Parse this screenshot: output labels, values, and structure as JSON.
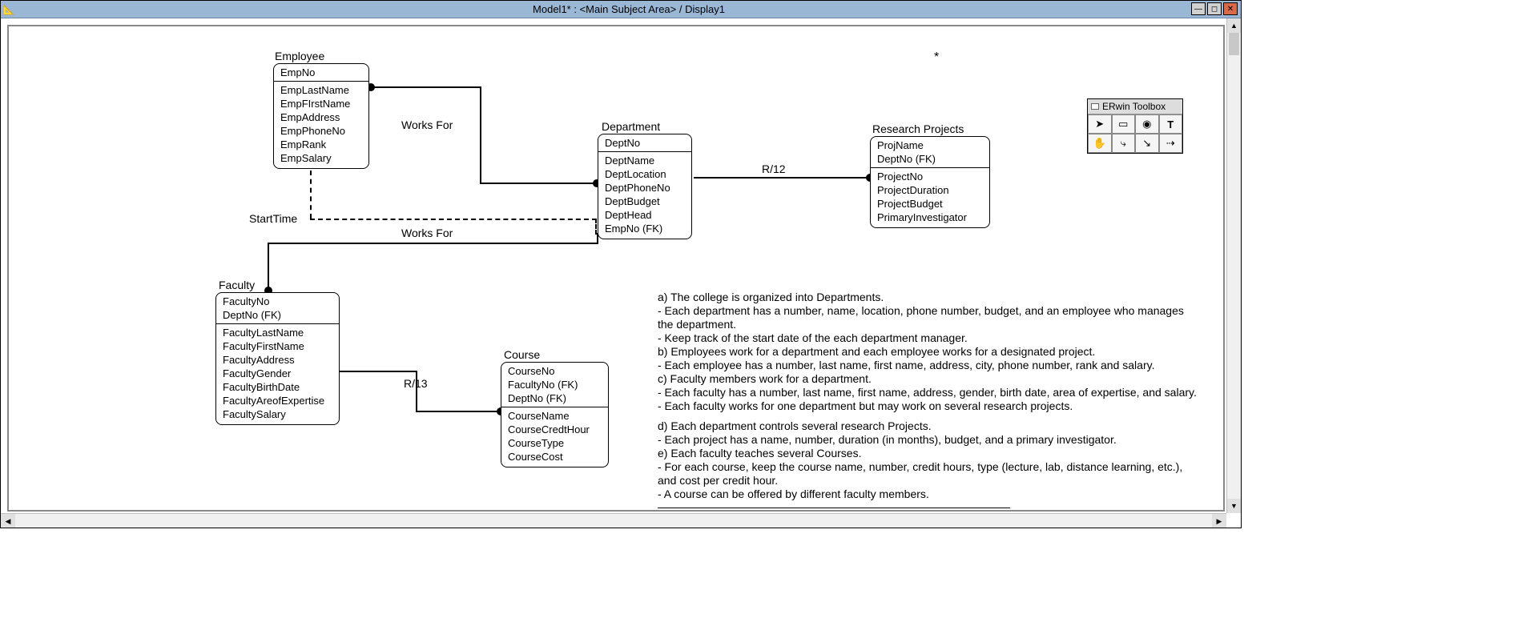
{
  "window": {
    "title": "Model1* : <Main Subject Area> / Display1",
    "icon": "📐"
  },
  "toolbox": {
    "title": "ERwin Toolbox",
    "buttons": [
      "arrow",
      "entity-box",
      "label-stamp",
      "text-T",
      "hand",
      "one-many",
      "many-many",
      "sub-cat"
    ]
  },
  "entities": {
    "employee": {
      "label": "Employee",
      "pk": [
        "EmpNo"
      ],
      "attrs": [
        "EmpLastName",
        "EmpFIrstName",
        "EmpAddress",
        "EmpPhoneNo",
        "EmpRank",
        "EmpSalary"
      ]
    },
    "department": {
      "label": "Department",
      "pk": [
        "DeptNo"
      ],
      "attrs": [
        "DeptName",
        "DeptLocation",
        "DeptPhoneNo",
        "DeptBudget",
        "DeptHead",
        "EmpNo (FK)"
      ]
    },
    "research": {
      "label": "Research Projects",
      "pk": [
        "ProjName",
        "DeptNo (FK)"
      ],
      "attrs": [
        "ProjectNo",
        "ProjectDuration",
        "ProjectBudget",
        "PrimaryInvestigator"
      ]
    },
    "faculty": {
      "label": "Faculty",
      "pk": [
        "FacultyNo",
        "DeptNo (FK)"
      ],
      "attrs": [
        "FacultyLastName",
        "FacultyFirstName",
        "FacultyAddress",
        "FacultyGender",
        "FacultyBirthDate",
        "FacultyAreofExpertise",
        "FacultySalary"
      ]
    },
    "course": {
      "label": "Course",
      "pk": [
        "CourseNo",
        "FacultyNo (FK)",
        "DeptNo (FK)"
      ],
      "attrs": [
        "CourseName",
        "CourseCredtHour",
        "CourseType",
        "CourseCost"
      ]
    }
  },
  "relationships": {
    "works_for_1": "Works For",
    "works_for_2": "Works For",
    "start_time": "StartTime",
    "r12": "R/12",
    "r13": "R/13"
  },
  "asterisk": "*",
  "notes": {
    "lines": [
      "a) The college is organized into Departments.",
      "- Each department has a number, name, location, phone number, budget, and an employee who manages the department.",
      "- Keep track of the start date of the each department manager.",
      "b) Employees work for a department and each employee works for a designated project.",
      "- Each employee has a number, last name, first name, address, city, phone number, rank and salary.",
      "c) Faculty members work for a department.",
      "- Each faculty has a number, last name, first name, address, gender, birth date, area of expertise, and salary.",
      "- Each faculty works for one department but may work on several research projects.",
      "",
      "d) Each department controls several research Projects.",
      "- Each project has a name, number, duration (in months), budget, and a primary investigator.",
      "e) Each faculty teaches several Courses.",
      "- For each course, keep the course name, number, credit hours, type (lecture, lab, distance learning, etc.), and cost per credit hour.",
      "- A course can be offered by different faculty members."
    ]
  }
}
